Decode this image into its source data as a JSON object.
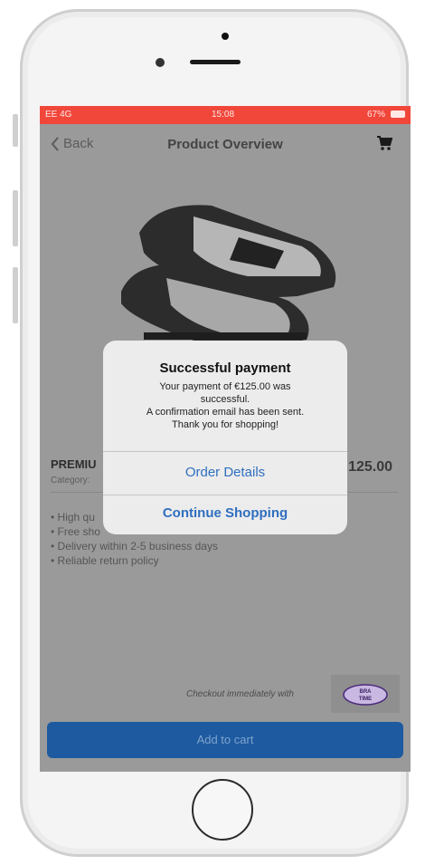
{
  "status_bar": {
    "carrier": "EE 4G",
    "time": "15:08",
    "battery": "67%"
  },
  "nav": {
    "back_label": "Back",
    "title": "Product Overview"
  },
  "product": {
    "name": "PREMIU",
    "category_label": "Category:",
    "price": "125.00",
    "features": [
      "• High qu",
      "• Free sho",
      "• Delivery within 2-5 business days",
      "• Reliable return policy"
    ]
  },
  "checkout": {
    "text": "Checkout immediately with",
    "logo_text_top": "BRA",
    "logo_text_bottom": "TIME"
  },
  "add_to_cart_label": "Add to cart",
  "dialog": {
    "title": "Successful payment",
    "message_lines": [
      "Your payment of €125.00 was",
      "successful.",
      "A confirmation email has been sent.",
      "Thank you for shopping!"
    ],
    "order_details_label": "Order Details",
    "continue_label": "Continue Shopping"
  },
  "colors": {
    "status_bar": "#f0473a",
    "button_blue": "#1d5aa0",
    "link_blue": "#2f6fc0"
  }
}
